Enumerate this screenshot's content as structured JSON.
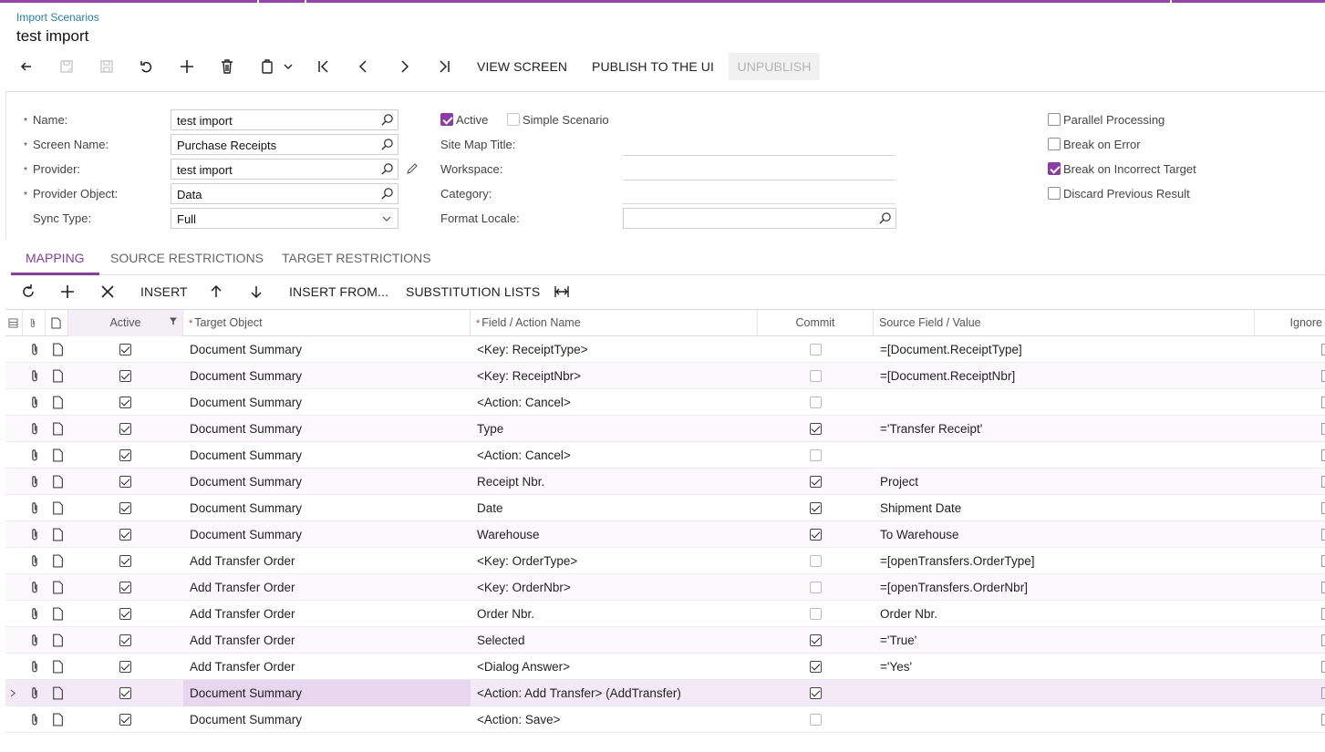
{
  "breadcrumb": "Import Scenarios",
  "title": "test import",
  "toolbar": {
    "view_screen": "VIEW SCREEN",
    "publish": "PUBLISH TO THE UI",
    "unpublish": "UNPUBLISH"
  },
  "form": {
    "name_label": "Name:",
    "name_value": "test import",
    "screen_label": "Screen Name:",
    "screen_value": "Purchase Receipts",
    "provider_label": "Provider:",
    "provider_value": "test import",
    "provider_object_label": "Provider Object:",
    "provider_object_value": "Data",
    "sync_label": "Sync Type:",
    "sync_value": "Full",
    "active_label": "Active",
    "simple_label": "Simple Scenario",
    "sitemap_label": "Site Map Title:",
    "workspace_label": "Workspace:",
    "category_label": "Category:",
    "locale_label": "Format Locale:",
    "parallel_label": "Parallel Processing",
    "break_error_label": "Break on Error",
    "break_target_label": "Break on Incorrect Target",
    "discard_label": "Discard Previous Result"
  },
  "tabs": [
    "MAPPING",
    "SOURCE RESTRICTIONS",
    "TARGET RESTRICTIONS"
  ],
  "grid_toolbar": {
    "insert": "INSERT",
    "insert_from": "INSERT FROM...",
    "substitution": "SUBSTITUTION LISTS"
  },
  "grid": {
    "headers": {
      "active": "Active",
      "target": "Target Object",
      "field": "Field / Action Name",
      "commit": "Commit",
      "source": "Source Field / Value",
      "ignore": "Ignore"
    },
    "rows": [
      {
        "active": true,
        "target": "Document Summary",
        "field": "<Key: ReceiptType>",
        "commit": false,
        "source": "=[Document.ReceiptType]"
      },
      {
        "active": true,
        "target": "Document Summary",
        "field": "<Key: ReceiptNbr>",
        "commit": false,
        "source": "=[Document.ReceiptNbr]"
      },
      {
        "active": true,
        "target": "Document Summary",
        "field": "<Action: Cancel>",
        "commit": false,
        "source": ""
      },
      {
        "active": true,
        "target": "Document Summary",
        "field": "Type",
        "commit": true,
        "source": "='Transfer Receipt'"
      },
      {
        "active": true,
        "target": "Document Summary",
        "field": "<Action: Cancel>",
        "commit": false,
        "source": ""
      },
      {
        "active": true,
        "target": "Document Summary",
        "field": "Receipt Nbr.",
        "commit": true,
        "source": "Project"
      },
      {
        "active": true,
        "target": "Document Summary",
        "field": "Date",
        "commit": true,
        "source": "Shipment Date"
      },
      {
        "active": true,
        "target": "Document Summary",
        "field": "Warehouse",
        "commit": true,
        "source": "To Warehouse"
      },
      {
        "active": true,
        "target": "Add Transfer Order",
        "field": "<Key: OrderType>",
        "commit": false,
        "source": "=[openTransfers.OrderType]"
      },
      {
        "active": true,
        "target": "Add Transfer Order",
        "field": "<Key: OrderNbr>",
        "commit": false,
        "source": "=[openTransfers.OrderNbr]"
      },
      {
        "active": true,
        "target": "Add Transfer Order",
        "field": "Order Nbr.",
        "commit": false,
        "source": "Order Nbr."
      },
      {
        "active": true,
        "target": "Add Transfer Order",
        "field": "Selected",
        "commit": true,
        "source": "='True'"
      },
      {
        "active": true,
        "target": "Add Transfer Order",
        "field": "<Dialog Answer>",
        "commit": true,
        "source": "='Yes'"
      },
      {
        "active": true,
        "target": "Document Summary",
        "field": "<Action: Add Transfer> (AddTransfer)",
        "commit": true,
        "source": ""
      },
      {
        "active": true,
        "target": "Document Summary",
        "field": "<Action: Save>",
        "commit": false,
        "source": ""
      }
    ]
  }
}
